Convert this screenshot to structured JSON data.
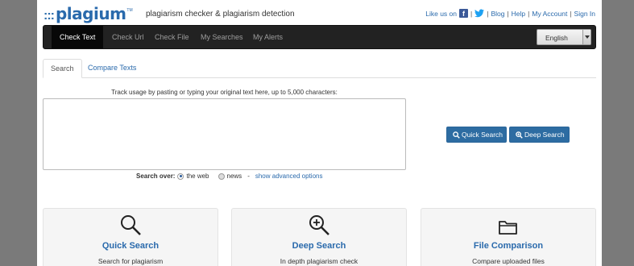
{
  "header": {
    "logo_dots": ":::",
    "logo_text": "plagium",
    "logo_tm": "TM",
    "tagline": "plagiarism checker & plagiarism detection",
    "like_us": "Like us on",
    "links": [
      "Blog",
      "Help",
      "My Account",
      "Sign In"
    ]
  },
  "nav": {
    "items": [
      "Check Text",
      "Check Url",
      "Check File",
      "My Searches",
      "My Alerts"
    ],
    "language": "English"
  },
  "tabs": [
    "Search",
    "Compare Texts"
  ],
  "search": {
    "hint": "Track usage by pasting or typing your original text here, up to 5,000 characters:",
    "text_value": "",
    "quick_button": "Quick Search",
    "deep_button": "Deep Search",
    "search_over": "Search over:",
    "option_web": "the web",
    "option_news": "news",
    "separator": "-",
    "advanced": "show advanced options"
  },
  "cards": [
    {
      "icon": "magnifier-icon",
      "title": "Quick Search",
      "desc": "Search for plagiarism"
    },
    {
      "icon": "zoom-in-icon",
      "title": "Deep Search",
      "desc": "In depth plagiarism check"
    },
    {
      "icon": "folder-icon",
      "title": "File Comparison",
      "desc": "Compare uploaded files"
    }
  ],
  "colors": {
    "brand": "#2a6aac",
    "navbar": "#222222",
    "button": "#2d6ca2",
    "facebook": "#3b5998",
    "twitter": "#1da1f2"
  }
}
